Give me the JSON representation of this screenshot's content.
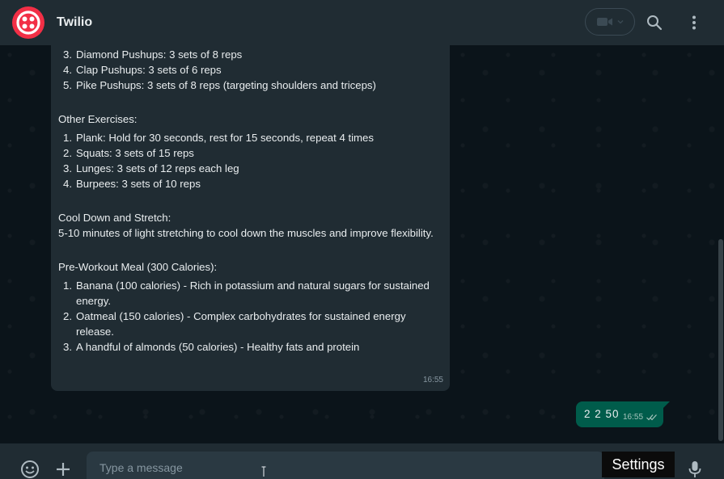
{
  "header": {
    "contact_name": "Twilio",
    "avatar_icon": "twilio-logo-icon",
    "video_icon": "video-camera-icon",
    "search_icon": "search-icon",
    "menu_icon": "kebab-menu-icon"
  },
  "incoming_message": {
    "workout_list_cont": [
      {
        "num": "3.",
        "text": "Diamond Pushups: 3 sets of 8 reps"
      },
      {
        "num": "4.",
        "text": "Clap Pushups: 3 sets of 6 reps"
      },
      {
        "num": "5.",
        "text": "Pike Pushups: 3 sets of 8 reps (targeting shoulders and triceps)"
      }
    ],
    "other_title": "Other Exercises:",
    "other_list": [
      {
        "num": "1.",
        "text": "Plank: Hold for 30 seconds, rest for 15 seconds, repeat 4 times"
      },
      {
        "num": "2.",
        "text": "Squats: 3 sets of 15 reps"
      },
      {
        "num": "3.",
        "text": "Lunges: 3 sets of 12 reps each leg"
      },
      {
        "num": "4.",
        "text": "Burpees: 3 sets of 10 reps"
      }
    ],
    "cooldown_title": "Cool Down and Stretch:",
    "cooldown_text": "5-10 minutes of light stretching to cool down the muscles and improve flexibility.",
    "meal_title": "Pre-Workout Meal (300 Calories):",
    "meal_list": [
      {
        "num": "1.",
        "text": "Banana (100 calories) - Rich in potassium and natural sugars for sustained energy."
      },
      {
        "num": "2.",
        "text": "Oatmeal (150 calories) - Complex carbohydrates for sustained energy release."
      },
      {
        "num": "3.",
        "text": "A handful of almonds (50 calories) - Healthy fats and protein"
      }
    ],
    "time": "16:55"
  },
  "outgoing_message": {
    "text": "2 2 50",
    "time": "16:55",
    "status_icon": "double-check-icon"
  },
  "footer": {
    "emoji_icon": "emoji-icon",
    "attach_icon": "plus-icon",
    "input_placeholder": "Type a message",
    "mic_icon": "microphone-icon"
  },
  "tooltip": {
    "label": "Settings"
  },
  "colors": {
    "header_bg": "#202c33",
    "chat_bg": "#0b141a",
    "incoming_bubble": "#202c33",
    "outgoing_bubble": "#005c4b",
    "brand_red": "#f22f46"
  }
}
